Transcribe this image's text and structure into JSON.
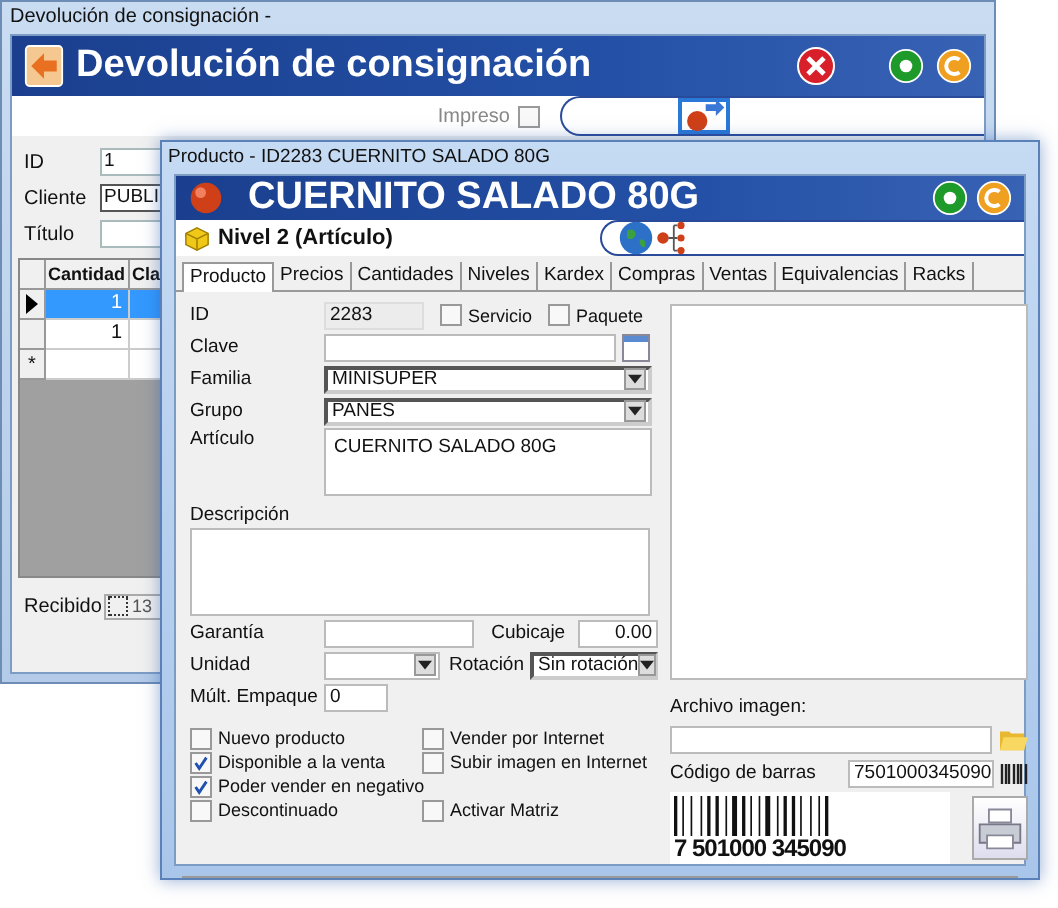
{
  "back_window": {
    "title": "Devolución de consignación -",
    "header": "Devolución de consignación",
    "printed": {
      "label": "Impreso",
      "checked": false
    },
    "fields": [
      {
        "label": "ID",
        "value": "1"
      },
      {
        "label": "Cliente",
        "value": "PUBLI"
      },
      {
        "label": "Título"
      }
    ],
    "grid": {
      "columns": [
        "Cantidad",
        "Cla"
      ],
      "rows": [
        {
          "cells": [
            "1"
          ],
          "selected": true
        },
        {
          "cells": [
            "1"
          ],
          "selected": false
        }
      ],
      "new_row_marker": "*"
    },
    "received": {
      "label": "Recibido",
      "value": "13"
    }
  },
  "product_window": {
    "title": "Producto - ID2283  CUERNITO SALADO 80G",
    "header": "CUERNITO SALADO 80G",
    "level": "Nivel 2 (Artículo)",
    "tabs": [
      {
        "label": "Producto",
        "selected": true
      },
      {
        "label": "Precios",
        "selected": false
      },
      {
        "label": "Cantidades",
        "selected": false
      },
      {
        "label": "Niveles",
        "selected": false
      },
      {
        "label": "Kardex",
        "selected": false
      },
      {
        "label": "Compras",
        "selected": false
      },
      {
        "label": "Ventas",
        "selected": false
      },
      {
        "label": "Equivalencias",
        "selected": false
      },
      {
        "label": "Racks",
        "selected": false
      }
    ],
    "id": {
      "label": "ID",
      "value": "2283"
    },
    "flags": [
      {
        "label": "Servicio",
        "checked": false
      },
      {
        "label": "Paquete",
        "checked": false
      }
    ],
    "key": {
      "label": "Clave"
    },
    "family": {
      "label": "Familia",
      "value": "MINISUPER"
    },
    "group": {
      "label": "Grupo",
      "value": "PANES"
    },
    "article": {
      "label": "Artículo",
      "value": "CUERNITO SALADO 80G"
    },
    "description": {
      "label": "Descripción"
    },
    "warranty": {
      "label": "Garantía"
    },
    "volume": {
      "label": "Cubicaje",
      "value": "0.00"
    },
    "unit": {
      "label": "Unidad"
    },
    "rotation": {
      "label": "Rotación",
      "value": "Sin rotación"
    },
    "pack": {
      "label": "Múlt. Empaque",
      "value": "0"
    },
    "options": [
      {
        "label": "Nuevo producto",
        "checked": false
      },
      {
        "label": "Vender por Internet",
        "checked": false
      },
      {
        "label": "Disponible a la venta",
        "checked": true
      },
      {
        "label": "Subir imagen en Internet",
        "checked": false
      },
      {
        "label": "Poder vender en negativo",
        "checked": true
      },
      {
        "label": "Descontinuado",
        "checked": false
      },
      {
        "label": "Activar Matriz",
        "checked": false
      }
    ],
    "image_file": {
      "label": "Archivo imagen:"
    },
    "barcode": {
      "label": "Código de barras",
      "value": "7501000345090",
      "printed_text": "7 501000 345090"
    }
  }
}
